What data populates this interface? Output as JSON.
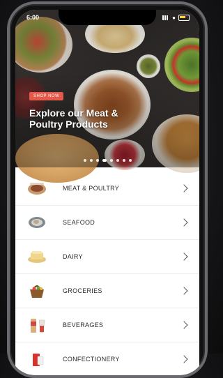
{
  "status_bar": {
    "time": "6:00"
  },
  "hero": {
    "cta_label": "SHOP NOW",
    "title": "Explore our Meat & Poultry Products",
    "slides_total": 8,
    "active_slide": 3
  },
  "categories": [
    {
      "label": "MEAT & POULTRY",
      "icon": "meat-icon"
    },
    {
      "label": "SEAFOOD",
      "icon": "seafood-icon"
    },
    {
      "label": "DAIRY",
      "icon": "dairy-icon"
    },
    {
      "label": "GROCERIES",
      "icon": "groceries-icon"
    },
    {
      "label": "BEVERAGES",
      "icon": "beverages-icon"
    },
    {
      "label": "CONFECTIONERY",
      "icon": "confectionery-icon"
    }
  ],
  "colors": {
    "accent": "#e45a4a",
    "background": "#1a1a1c"
  }
}
